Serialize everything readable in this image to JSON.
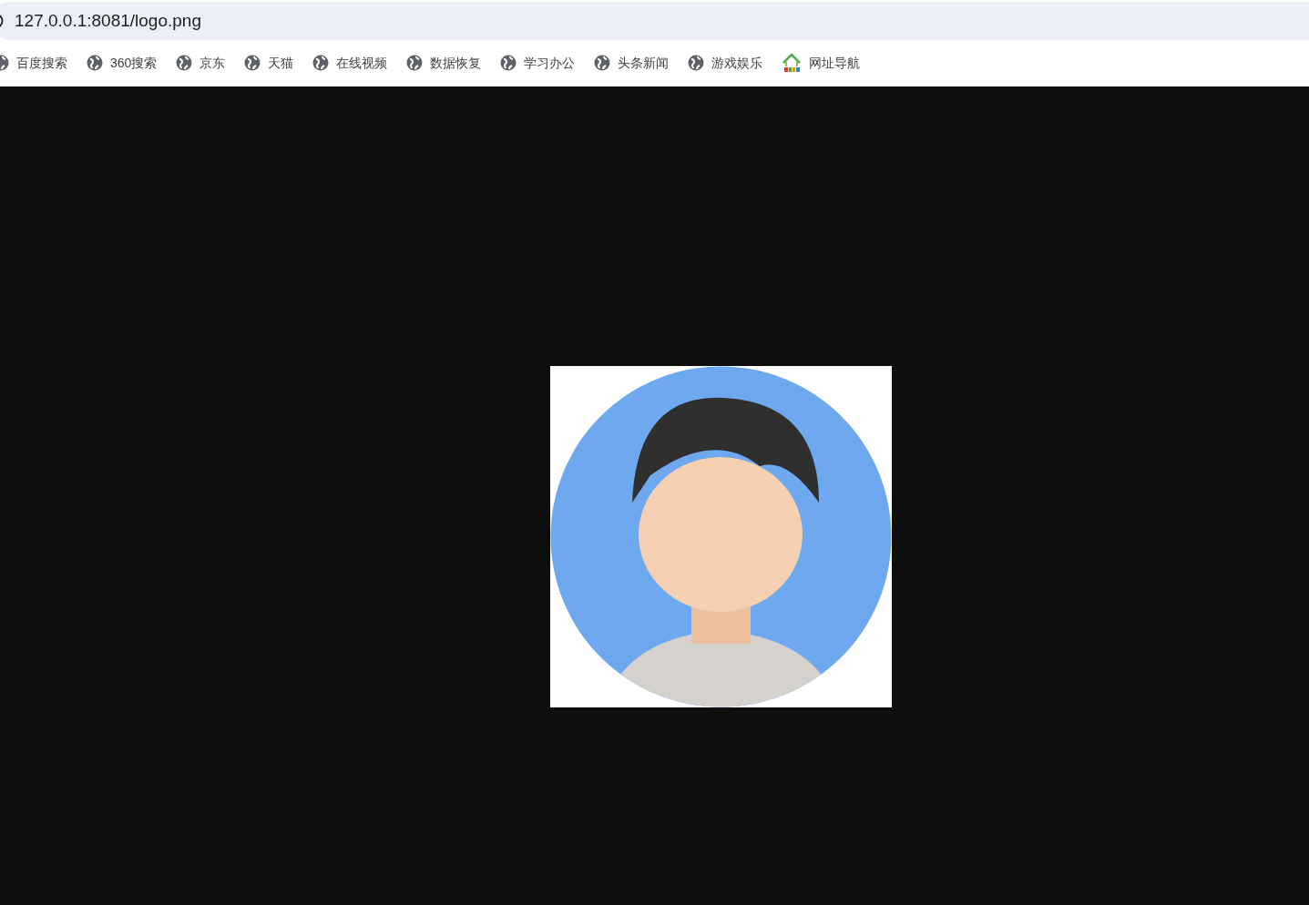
{
  "address_bar": {
    "url": "127.0.0.1:8081/logo.png"
  },
  "bookmarks": [
    {
      "label": "百度搜索",
      "kind": "globe"
    },
    {
      "label": "360搜索",
      "kind": "globe"
    },
    {
      "label": "京东",
      "kind": "globe"
    },
    {
      "label": "天猫",
      "kind": "globe"
    },
    {
      "label": "在线视频",
      "kind": "globe"
    },
    {
      "label": "数据恢复",
      "kind": "globe"
    },
    {
      "label": "学习办公",
      "kind": "globe"
    },
    {
      "label": "头条新闻",
      "kind": "globe"
    },
    {
      "label": "游戏娱乐",
      "kind": "globe"
    },
    {
      "label": "网址导航",
      "kind": "house"
    }
  ]
}
